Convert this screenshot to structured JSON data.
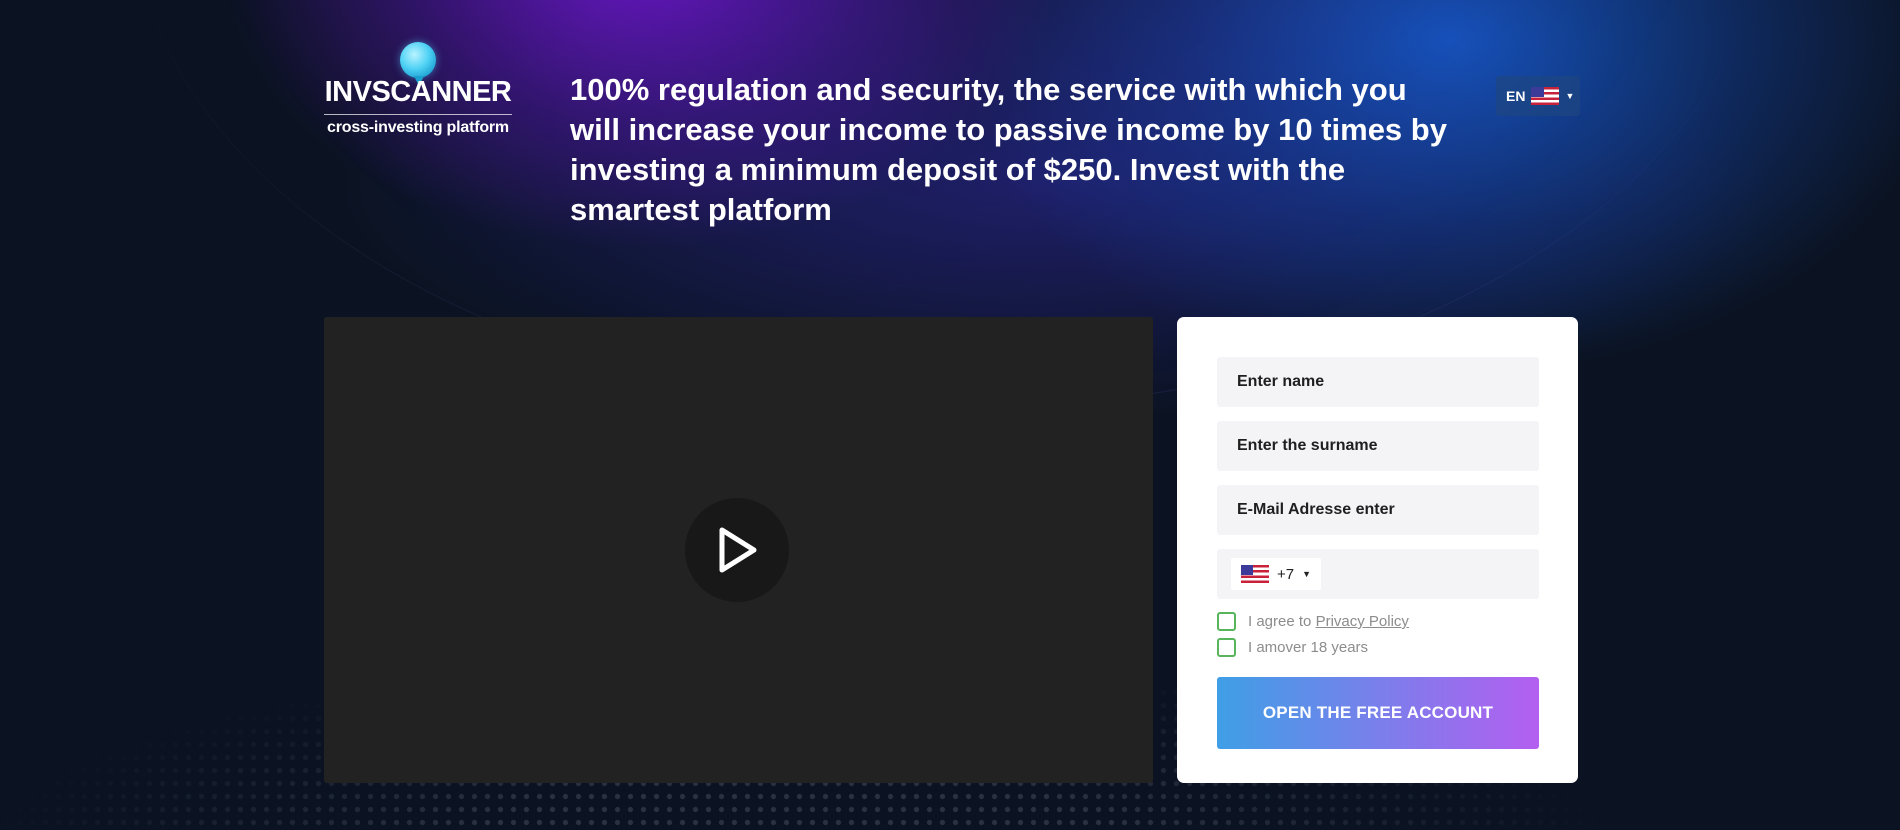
{
  "brand": {
    "name": "INVSCANNER",
    "tagline": "cross-investing platform"
  },
  "headline": "100% regulation and security, the service with which you will increase your income to passive income by 10 times by investing a minimum deposit of $250. Invest with the smartest platform",
  "language": {
    "code": "EN",
    "flag": "us-flag-icon"
  },
  "video": {
    "play_icon": "play-icon"
  },
  "form": {
    "name_placeholder": "Enter name",
    "surname_placeholder": "Enter the surname",
    "email_placeholder": "E-Mail Adresse enter",
    "phone": {
      "country_flag": "us-flag-icon",
      "dial_code": "+7"
    },
    "agree_prefix": "I agree to",
    "privacy_link": "Privacy Policy",
    "age_label": "I amover 18 years",
    "submit_label": "OPEN THE FREE ACCOUNT"
  },
  "colors": {
    "page_bg": "#0b1322",
    "button_gradient_start": "#3f9fe6",
    "button_gradient_end": "#b45ff0",
    "checkbox_border": "#58b55b",
    "video_bg": "#222222"
  }
}
